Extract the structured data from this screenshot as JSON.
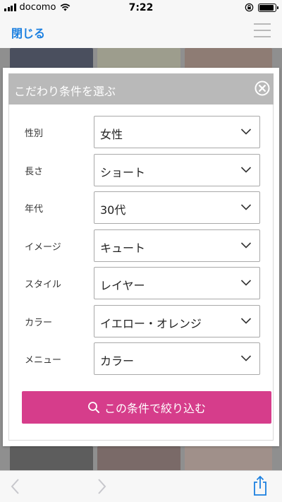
{
  "status_bar": {
    "carrier": "docomo",
    "time": "7:22",
    "battery_level": 0.9
  },
  "nav": {
    "close_label": "閉じる"
  },
  "modal": {
    "title": "こだわり条件を選ぶ",
    "filters": [
      {
        "label": "性別",
        "value": "女性"
      },
      {
        "label": "長さ",
        "value": "ショート"
      },
      {
        "label": "年代",
        "value": "30代"
      },
      {
        "label": "イメージ",
        "value": "キュート"
      },
      {
        "label": "スタイル",
        "value": "レイヤー"
      },
      {
        "label": "カラー",
        "value": "イエロー・オレンジ"
      },
      {
        "label": "メニュー",
        "value": "カラー"
      }
    ],
    "search_button_label": "この条件で絞り込む"
  },
  "colors": {
    "accent_blue": "#1a7fe0",
    "header_gray": "#b9b9b9",
    "button_pink": "#d63d8b"
  },
  "icons": [
    "signal-icon",
    "wifi-icon",
    "rotation-lock-icon",
    "battery-icon",
    "hamburger-menu-icon",
    "close-circle-icon",
    "chevron-down-icon",
    "search-icon",
    "back-arrow-icon",
    "forward-arrow-icon",
    "share-icon"
  ]
}
